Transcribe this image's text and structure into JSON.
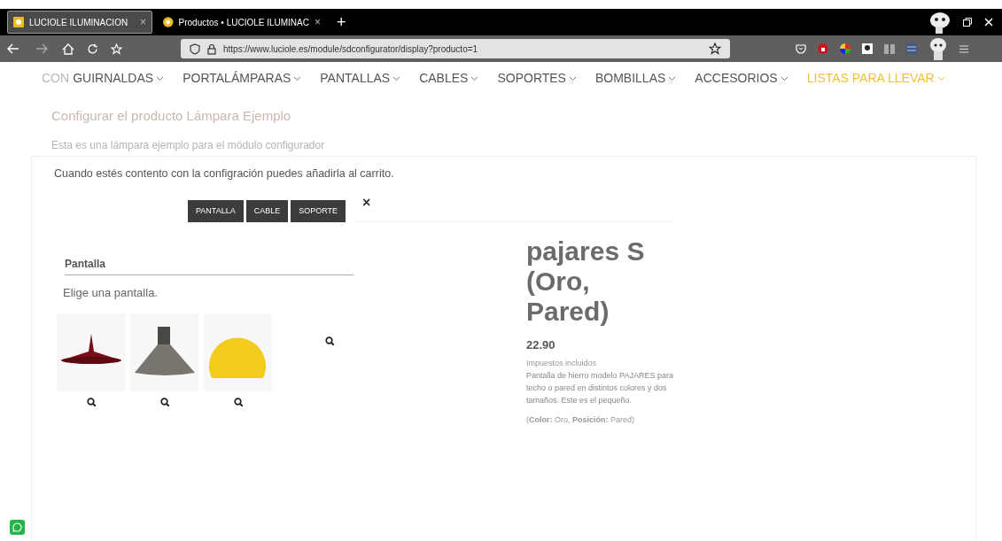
{
  "browser": {
    "tabs": [
      {
        "title": "LUCIOLE ILUMINACION",
        "selected": true,
        "close": "×"
      },
      {
        "title": "Productos • LUCIOLE ILUMINAC",
        "selected": false,
        "close": "×"
      }
    ],
    "new_tab": "+",
    "url": "https://www.luciole.es/module/sdconfigurator/display?producto=1"
  },
  "nav": {
    "items": [
      {
        "label": "GUIRNALDAS",
        "highlighted": false
      },
      {
        "label": "PORTALÁMPARAS",
        "highlighted": false
      },
      {
        "label": "PANTALLAS",
        "highlighted": false
      },
      {
        "label": "CABLES",
        "highlighted": false
      },
      {
        "label": "SOPORTES",
        "highlighted": false
      },
      {
        "label": "BOMBILLAS",
        "highlighted": false
      },
      {
        "label": "ACCESORIOS",
        "highlighted": false
      },
      {
        "label": "LISTAS PARA LLEVAR",
        "highlighted": true
      }
    ]
  },
  "faded_header": {
    "heading": "CON",
    "title": "Configurar el producto Lámpara Ejemplo",
    "description": "Esta es una lámpara ejemplo para el módulo configurador"
  },
  "intro": "Cuando estés contento con la configración puedes añadirla al carrito.",
  "configurator": {
    "tabs": [
      {
        "label": "PANTALLA"
      },
      {
        "label": "CABLE"
      },
      {
        "label": "SOPORTE"
      }
    ],
    "close": "×",
    "section_title": "Pantalla",
    "hint": "Elige una pantalla.",
    "options": [
      {
        "kind": "red-shade"
      },
      {
        "kind": "grey-cone"
      },
      {
        "kind": "yellow-globe"
      },
      {
        "kind": "empty"
      }
    ]
  },
  "product": {
    "name": "pajares S (Oro, Pared)",
    "price": "22.90",
    "tax_note": "Impuestos incluidos",
    "description": "Pantalla de hierro modelo PAJARES para techo o pared en distintos colores y dos tamaños. Este es el pequeño.",
    "attributes": "(**Color:** Oro, **Posición:** Pared)"
  }
}
